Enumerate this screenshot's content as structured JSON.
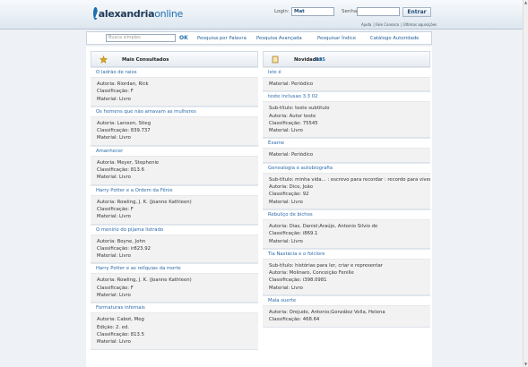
{
  "header": {
    "logo_bold": "alexandria",
    "logo_light": "online",
    "login_label": "Login:",
    "login_value": "Mat",
    "password_label": "Senha:",
    "submit_label": "Entrar",
    "links": [
      "Ajuda",
      "| Fale Conosco",
      "| Últimas aquisições"
    ]
  },
  "nav": {
    "search_placeholder": "Busca simples",
    "ok_label": "OK",
    "links": [
      "Pesquisa por Palavra",
      "Pesquisa Avançada",
      "Pesquisar Índice",
      "Catálogo Autoridade"
    ]
  },
  "left": {
    "title": "Mais Consultados",
    "icon": "star-icon",
    "items": [
      {
        "title": "O ladrão de raios",
        "lines": [
          "Autoria: Riordan, Rick",
          "Classificação: F",
          "Material: Livro"
        ]
      },
      {
        "title": "Os homens que não amavam as mulheres",
        "lines": [
          "Autoria: Larsson, Stieg",
          "Classificação: 839.737",
          "Material: Livro"
        ]
      },
      {
        "title": "Amanhecer",
        "lines": [
          "Autoria: Meyer, Stephenie",
          "Classificação: 813.6",
          "Material: Livro"
        ]
      },
      {
        "title": "Harry Potter e a Ordem da Fênix",
        "lines": [
          "Autoria: Rowling, J. K. (Joanne Kathleen)",
          "Classificação: F",
          "Material: Livro"
        ]
      },
      {
        "title": "O menino do pijama listrado",
        "lines": [
          "Autoria: Boyne, John",
          "Classificação: ir823.92",
          "Material: Livro"
        ]
      },
      {
        "title": "Harry Potter e as relíquias da morte",
        "lines": [
          "Autoria: Rowling, J. K. (Joanne Kathleen)",
          "Classificação: F",
          "Material: Livro"
        ]
      },
      {
        "title": "Formaturas infernais",
        "lines": [
          "Autoria: Cabot, Meg",
          "Edição: 2. ed.",
          "Classificação: 813.5",
          "Material: Livro"
        ]
      }
    ]
  },
  "right": {
    "title": "Novidades",
    "rss": "RSS",
    "icon": "book-icon",
    "items": [
      {
        "title": "Isto é",
        "lines": [
          "Material: Periódico"
        ]
      },
      {
        "title": "teste inclusao 3.3 02",
        "lines": [
          "Sub-título: teste subtitulo",
          "Autoria: Autor teste",
          "Classificação: 75545",
          "Material: Livro"
        ]
      },
      {
        "title": "Exame",
        "lines": [
          "Material: Periódico"
        ]
      },
      {
        "title": "Genealogia e autobiografia",
        "lines": [
          "Sub-título: minha vida... : escrevo para recordar : recordo para viver",
          "Autoria: Dico, João",
          "Classificação: 92",
          "Material: Livro"
        ]
      },
      {
        "title": "Rebuliço de bichos",
        "lines": [
          "Autoria: Dias, Daniel;Araújo, Antonio Silvio de",
          "Classificação: i869.1",
          "Material: Livro"
        ]
      },
      {
        "title": "Tia Nastácia e o folclore",
        "lines": [
          "Sub-título: histórias para ler, criar e representar",
          "Autoria: Molinaro, Conceição Fenille",
          "Classificação: i398.0981",
          "Material: Livro"
        ]
      },
      {
        "title": "Mala suerte",
        "lines": [
          "Autoria: Orejudo, Antonio;González Vella, Helena",
          "Classificação: 468.64"
        ]
      }
    ]
  }
}
